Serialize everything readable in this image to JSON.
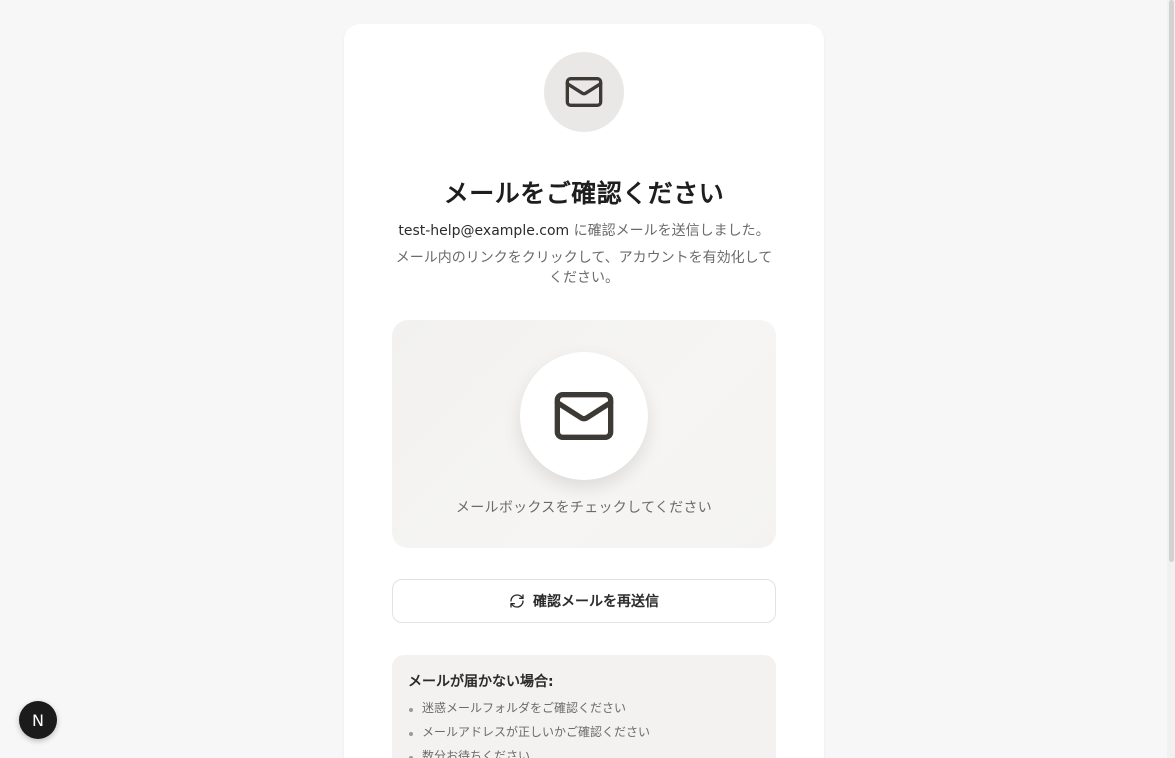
{
  "header": {
    "title": "メールをご確認ください",
    "email": "test-help@example.com",
    "sent_suffix": " に確認メールを送信しました。",
    "instruction": "メール内のリンクをクリックして、アカウントを有効化してください。"
  },
  "mailbox": {
    "caption": "メールボックスをチェックしてください"
  },
  "actions": {
    "resend_label": "確認メールを再送信"
  },
  "help": {
    "title": "メールが届かない場合:",
    "items": [
      "迷惑メールフォルダをご確認ください",
      "メールアドレスが正しいかご確認ください",
      "数分お待ちください"
    ]
  },
  "badge": {
    "letter": "N"
  },
  "colors": {
    "background": "#f7f7f7",
    "card": "#ffffff",
    "icon_stroke": "#3d3935",
    "muted_text": "#6b6b6b"
  },
  "icons": {
    "top": "mail-icon",
    "mailbox": "mail-icon",
    "resend": "refresh-icon"
  }
}
